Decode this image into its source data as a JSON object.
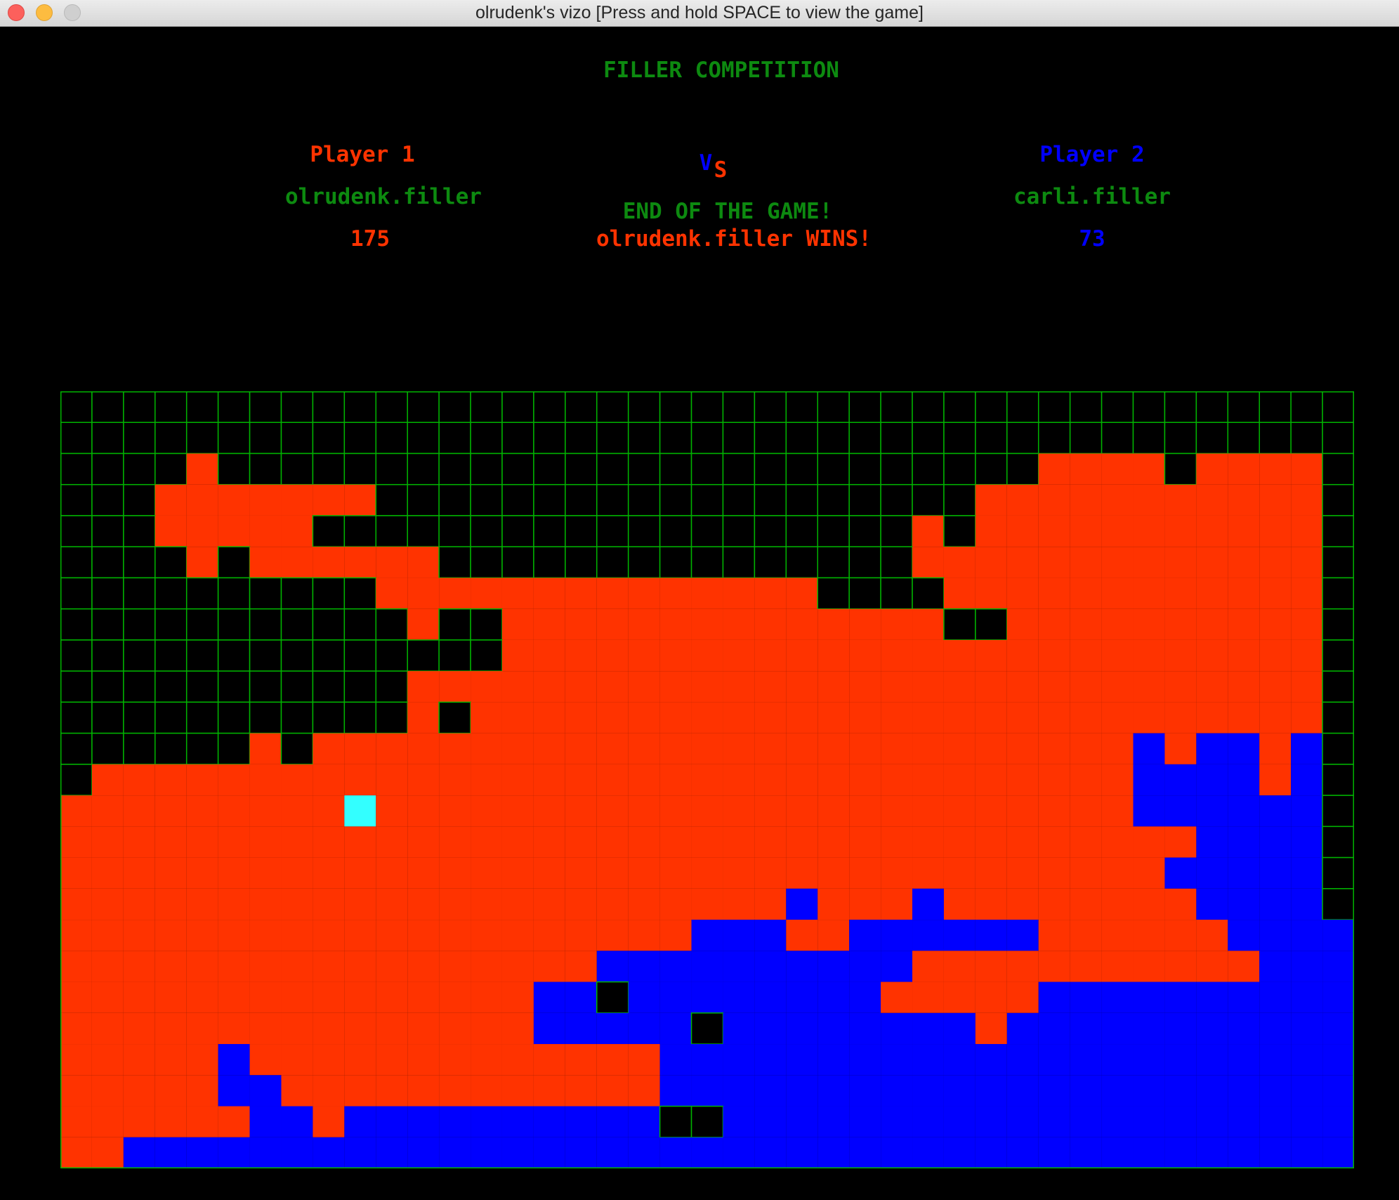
{
  "window": {
    "title": "olrudenk's vizo [Press and hold SPACE to view the game]"
  },
  "colors": {
    "green": "#0d8a10",
    "player1": "#ff3300",
    "player2": "#0000ff",
    "last_piece": "#33ffff",
    "empty": "#000000",
    "grid": "#00b300"
  },
  "header": {
    "title": "FILLER COMPETITION",
    "vs_v": "V",
    "vs_s": "S",
    "end_message": "END OF THE GAME!",
    "winner_message": "olrudenk.filler WINS!"
  },
  "player1": {
    "label": "Player 1",
    "name": "olrudenk.filler",
    "score": "175"
  },
  "player2": {
    "label": "Player 2",
    "name": "carli.filler",
    "score": "73"
  },
  "board": {
    "legend": {
      ".": "empty",
      "O": "player1",
      "X": "player2",
      "o": "last placed piece"
    },
    "rows": [
      "........................................",
      "........................................",
      "....O..........................OOOO.OOOO",
      "...OOOOOOO...................OOOOOOOOOOO",
      "...OOOOO...................O.OOOOOOOOOOO",
      "....O.OOOOOO...............OOOOOOOOOOOOO",
      "..........OOOOOOOOOOOOOO....OOOOOOOOOOOO",
      "...........O..OOOOOOOOOOOOOO..OOOOOOOOOO",
      "..............OOOOOOOOOOOOOOOOOOOOOOOOOO",
      "...........OOOOOOOOOOOOOOOOOOOOOOOOOOOOO",
      "...........O.OOOOOOOOOOOOOOOOOOOOOOOOOOO",
      "......O.OOOOOOOOOOOOOOOOOOOOOOOOOOXOXXOX",
      ".OOOOOOOOOOOOOOOOOOOOOOOOOOOOOOOOOXXXXOX",
      "OOOOOOOOOoOOOOOOOOOOOOOOOOOOOOOOOOXXXXXX",
      "OOOOOOOOOOOOOOOOOOOOOOOOOOOOOOOOOOOOXXXX",
      "OOOOOOOOOOOOOOOOOOOOOOOOOOOOOOOOOOOXXXXX",
      "OOOOOOOOOOOOOOOOOOOOOOOXOOOXOOOOOOOOXXXX",
      "OOOOOOOOOOOOOOOOOOOOXXXOOXXXXXXOOOOOOXXXX",
      "OOOOOOOOOOOOOOOOOXXXXXXXXXXOOOOOOOOOOOXXX",
      "OOOOOOOOOOOOOOOXX.XXXXXXXXOOOOOXXXXXXXXXX",
      "OOOOOOOOOOOOOOOXXXXX.XXXXXXXXOXXXXXXXXXXX",
      "OOOOOXOOOOOOOOOOOOOXXXXXXXXXXXXXXXXXXXXXX",
      "OOOOOXXOOOOOOOOOOOOXXXXXXXXXXXXXXXXXXXXXX",
      "OOOOOOXXOXXXXXXXXXX..XXXXXXXXXXXXXXXXXXXX",
      "OOXXXXXXXXXXXXXXXXXXXXXXXXXXXXXXXXXXXXXXX"
    ]
  }
}
